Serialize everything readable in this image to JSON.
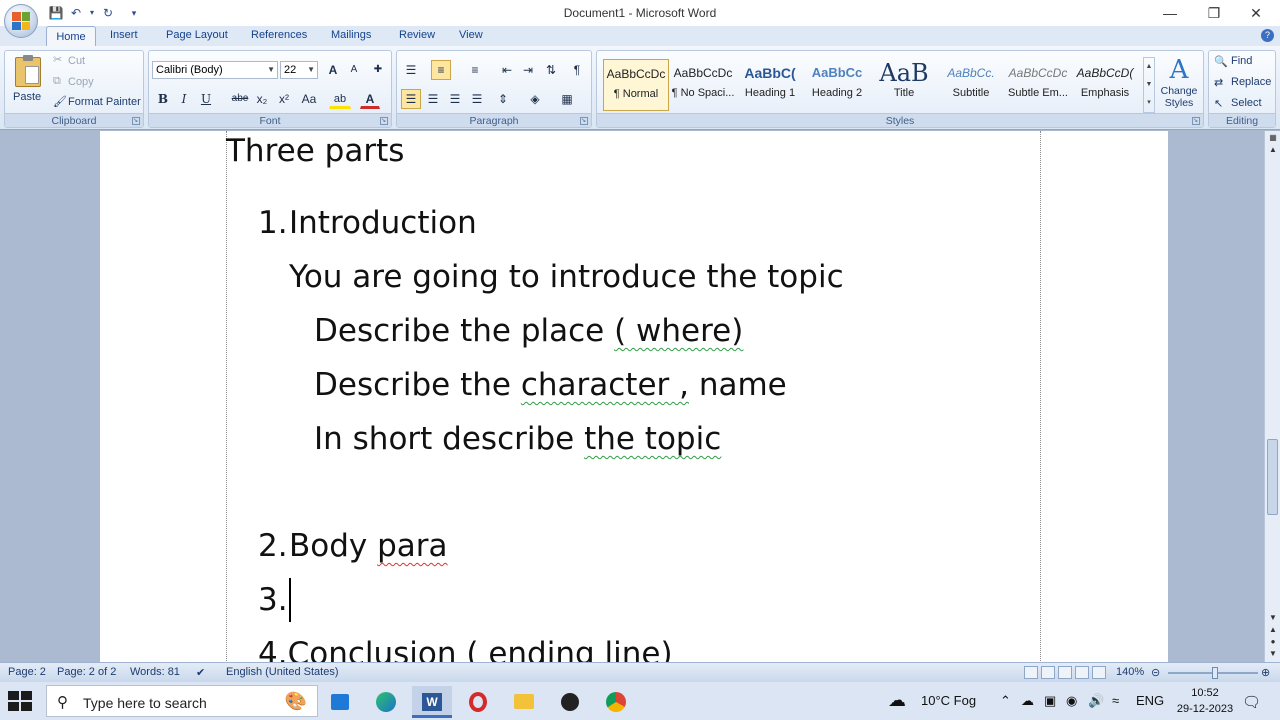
{
  "window": {
    "title": "Document1 - Microsoft Word"
  },
  "qat": {
    "save_icon": "save-icon",
    "undo_icon": "undo-icon",
    "redo_icon": "redo-icon"
  },
  "tabs": [
    "Home",
    "Insert",
    "Page Layout",
    "References",
    "Mailings",
    "Review",
    "View"
  ],
  "clipboard": {
    "paste": "Paste",
    "cut": "Cut",
    "copy": "Copy",
    "format_painter": "Format Painter",
    "label": "Clipboard"
  },
  "font": {
    "name": "Calibri (Body)",
    "size": "22",
    "label": "Font",
    "bold": "B",
    "italic": "I",
    "underline": "U",
    "strikethrough": "abe",
    "subscript": "x₂",
    "superscript": "x²",
    "change_case": "Aa",
    "highlight": "ab",
    "font_color": "A",
    "grow": "A",
    "shrink": "A"
  },
  "paragraph": {
    "label": "Paragraph",
    "pilcrow": "¶"
  },
  "styles": {
    "label": "Styles",
    "items": [
      {
        "preview": "AaBbCcDc",
        "name": "¶ Normal"
      },
      {
        "preview": "AaBbCcDc",
        "name": "¶ No Spaci..."
      },
      {
        "preview": "AaBbC(",
        "name": "Heading 1"
      },
      {
        "preview": "AaBbCc",
        "name": "Heading 2"
      },
      {
        "preview": "AaB",
        "name": "Title"
      },
      {
        "preview": "AaBbCc.",
        "name": "Subtitle"
      },
      {
        "preview": "AaBbCcDc",
        "name": "Subtle Em..."
      },
      {
        "preview": "AaBbCcD(",
        "name": "Emphasis"
      }
    ],
    "change_styles": "Change Styles"
  },
  "editing": {
    "find": "Find",
    "replace": "Replace",
    "select": "Select",
    "label": "Editing"
  },
  "document": {
    "heading": "Three parts",
    "item1_num": "1.",
    "item1_text": "Introduction",
    "intro_line": "You are going to introduce the topic",
    "describe_place_a": "Describe the place ",
    "describe_place_b": "( where)",
    "describe_char_a": "Describe the ",
    "describe_char_b": "character ,",
    "describe_char_c": " name",
    "short_a": "In short describe ",
    "short_b": "the  topic",
    "item2_num": "2.",
    "item2_a": "Body ",
    "item2_b": "para",
    "item3_num": "3.",
    "item4": "4.Conclusion ( ending line)"
  },
  "status": {
    "page": "Page: 2",
    "page_of": "Page: 2 of 2",
    "words": "Words: 81",
    "language": "English (United States)",
    "zoom": "140%"
  },
  "taskbar": {
    "search_placeholder": "Type here to search",
    "weather": "10°C  Fog",
    "lang": "ENG",
    "time": "10:52",
    "date": "29-12-2023"
  }
}
